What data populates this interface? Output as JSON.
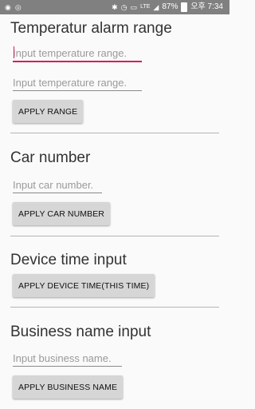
{
  "status_bar": {
    "battery": "87%",
    "network": "LTE",
    "time": "오후 7:34"
  },
  "sections": {
    "temperature": {
      "title": "Temperatur alarm range",
      "input1_placeholder": "Input temperature range.",
      "input2_placeholder": "Input temperature range.",
      "button": "APPLY RANGE"
    },
    "car": {
      "title": "Car number",
      "input_placeholder": "Input car number.",
      "button": "APPLY CAR NUMBER"
    },
    "device_time": {
      "title": "Device time input",
      "button": "APPLY DEVICE TIME(THIS TIME)"
    },
    "business": {
      "title": "Business name input",
      "input_placeholder": "Input business name.",
      "button": "APPLY BUSINESS NAME"
    }
  },
  "colors": {
    "accent": "#d81b60",
    "status_bar": "#808080",
    "button": "#d6d6d6"
  }
}
